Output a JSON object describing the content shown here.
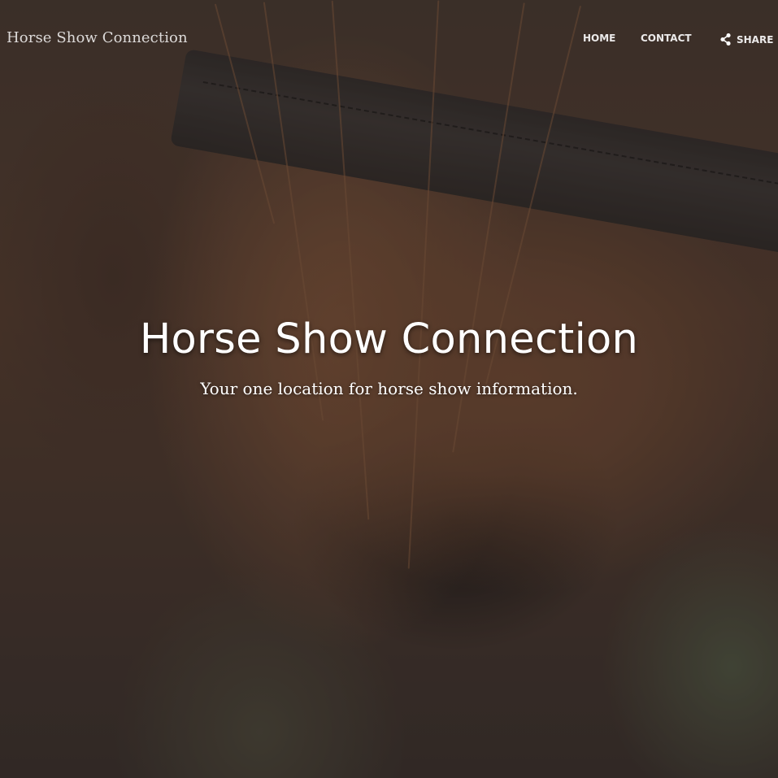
{
  "site": {
    "brand": "Horse Show Connection"
  },
  "nav": {
    "items": [
      {
        "label": "HOME"
      },
      {
        "label": "CONTACT"
      },
      {
        "label": "SHARE",
        "icon": "share-icon"
      }
    ]
  },
  "hero": {
    "title": "Horse Show Connection",
    "subtitle": "Your one location for horse show information.",
    "background_image": "close-up of a brown horse's muzzle wearing a dark halter"
  },
  "colors": {
    "text": "#ffffff",
    "overlay": "#231e1c"
  }
}
